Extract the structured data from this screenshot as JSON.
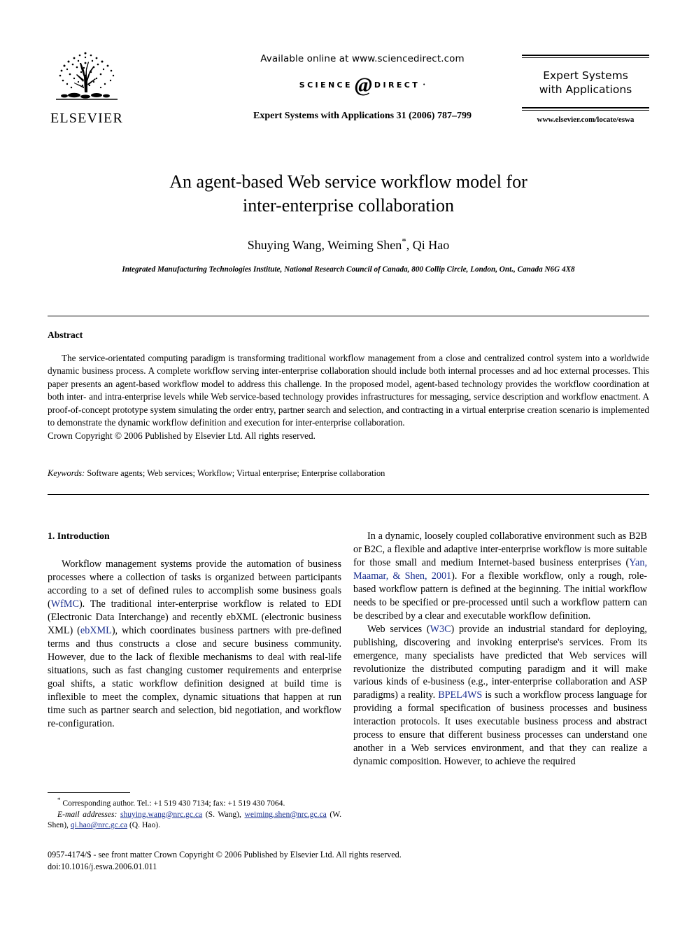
{
  "header": {
    "publisher_name": "ELSEVIER",
    "available_online": "Available online at www.sciencedirect.com",
    "sciencedirect_left": "SCIENCE",
    "sciencedirect_at": "@",
    "sciencedirect_right": "DIRECT",
    "sciencedirect_tm": "•",
    "journal_reference": "Expert Systems with Applications 31 (2006) 787–799",
    "masthead_line1": "Expert Systems",
    "masthead_line2": "with Applications",
    "masthead_url": "www.elsevier.com/locate/eswa"
  },
  "title": {
    "line1": "An agent-based Web service workflow model for",
    "line2": "inter-enterprise collaboration"
  },
  "authors": {
    "list": "Shuying Wang, Weiming Shen",
    "corresponding_marker": "*",
    "tail": ", Qi Hao",
    "affiliation": "Integrated Manufacturing Technologies Institute, National Research Council of Canada, 800 Collip Circle, London, Ont., Canada N6G 4X8"
  },
  "abstract": {
    "heading": "Abstract",
    "body": "The service-orientated computing paradigm is transforming traditional workflow management from a close and centralized control system into a worldwide dynamic business process. A complete workflow serving inter-enterprise collaboration should include both internal processes and ad hoc external processes. This paper presents an agent-based workflow model to address this challenge. In the proposed model, agent-based technology provides the workflow coordination at both inter- and intra-enterprise levels while Web service-based technology provides infrastructures for messaging, service description and workflow enactment. A proof-of-concept prototype system simulating the order entry, partner search and selection, and contracting in a virtual enterprise creation scenario is implemented to demonstrate the dynamic workflow definition and execution for inter-enterprise collaboration.",
    "copyright": "Crown Copyright © 2006 Published by Elsevier Ltd. All rights reserved.",
    "keywords_label": "Keywords:",
    "keywords_value": "Software agents; Web services; Workflow; Virtual enterprise; Enterprise collaboration"
  },
  "body": {
    "section1_heading": "1. Introduction",
    "left_para1_a": "Workflow management systems provide the automation of business processes where a collection of tasks is organized between participants according to a set of defined rules to accomplish some business goals (",
    "left_para1_ref1": "WfMC",
    "left_para1_b": "). The traditional inter-enterprise workflow is related to EDI (Electronic Data Interchange) and recently ebXML (electronic business XML) (",
    "left_para1_ref2": "ebXML",
    "left_para1_c": "), which coordinates business partners with pre-defined terms and thus constructs a close and secure business community. However, due to the lack of flexible mechanisms to deal with real-life situations, such as fast changing customer requirements and enterprise goal shifts, a static workflow definition designed at build time is inflexible to meet the complex, dynamic situations that happen at run time such as partner search and selection, bid negotiation, and workflow re-configuration.",
    "right_para1_a": "In a dynamic, loosely coupled collaborative environment such as B2B or B2C, a flexible and adaptive inter-enterprise workflow is more suitable for those small and medium Internet-based business enterprises (",
    "right_para1_ref": "Yan, Maamar, & Shen, 2001",
    "right_para1_b": "). For a flexible workflow, only a rough, role-based workflow pattern is defined at the beginning. The initial workflow needs to be specified or pre-processed until such a workflow pattern can be described by a clear and executable workflow definition.",
    "right_para2_a": "Web services (",
    "right_para2_ref1": "W3C",
    "right_para2_b": ") provide an industrial standard for deploying, publishing, discovering and invoking enterprise's services. From its emergence, many specialists have predicted that Web services will revolutionize the distributed computing paradigm and it will make various kinds of e-business (e.g., inter-enterprise collaboration and ASP paradigms) a reality. ",
    "right_para2_ref2": "BPEL4WS",
    "right_para2_c": " is such a workflow process language for providing a formal specification of business processes and business interaction protocols. It uses executable business process and abstract process to ensure that different business processes can understand one another in a Web services environment, and that they can realize a dynamic composition. However, to achieve the required"
  },
  "footnote": {
    "marker": "*",
    "corresponding": "Corresponding author. Tel.: +1 519 430 7134; fax: +1 519 430 7064.",
    "email_label": "E-mail addresses:",
    "email1": "shuying.wang@nrc.gc.ca",
    "email1_name": "(S. Wang),",
    "email2": "weiming.shen@nrc.gc.ca",
    "email2_name": "(W. Shen),",
    "email3": "qi.hao@nrc.gc.ca",
    "email3_name": "(Q. Hao)."
  },
  "foot": {
    "issn_line": "0957-4174/$ - see front matter Crown Copyright © 2006 Published by Elsevier Ltd. All rights reserved.",
    "doi_line": "doi:10.1016/j.eswa.2006.01.011"
  },
  "colors": {
    "link": "#1a2f8f",
    "text": "#000000",
    "background": "#ffffff"
  }
}
